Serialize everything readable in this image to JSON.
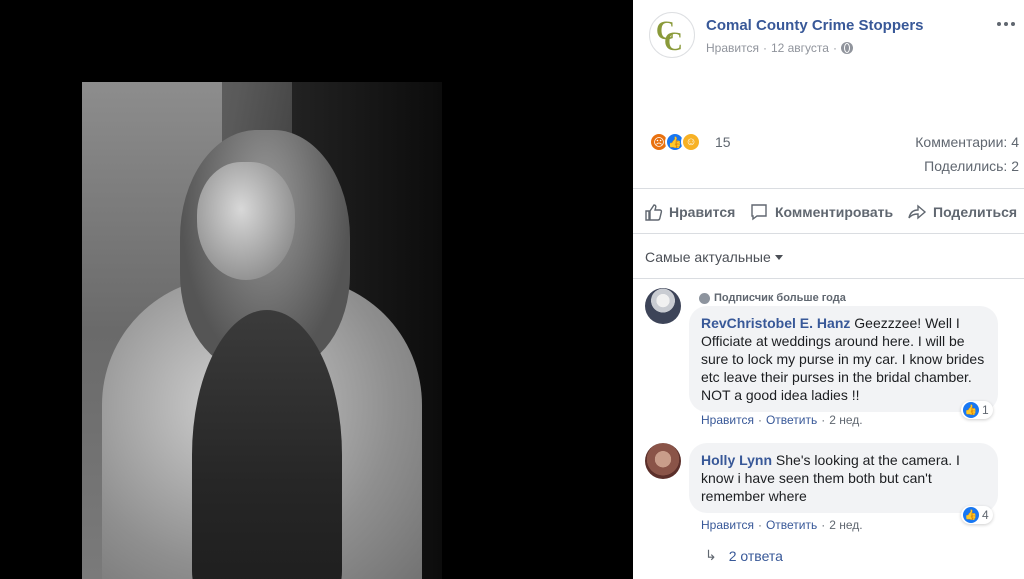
{
  "post": {
    "page_name": "Comal County Crime Stoppers",
    "like_label": "Нравится",
    "separator": "·",
    "date": "12 августа",
    "avatar_text": "CC"
  },
  "stats": {
    "reaction_count": "15",
    "comments": "Комментарии: 4",
    "shares": "Поделились: 2"
  },
  "actions": {
    "like": "Нравится",
    "comment": "Комментировать",
    "share": "Поделиться"
  },
  "sort": {
    "label": "Самые актуальные"
  },
  "comments": [
    {
      "badge": "Подписчик больше года",
      "author": "RevChristobel E. Hanz",
      "text": " Geezzzee! Well I Officiate at weddings around here. I will be sure to lock my purse in my car. I know brides etc leave their purses in the bridal chamber. NOT a good idea ladies !!",
      "like": "Нравится",
      "reply": "Ответить",
      "time": "2 нед.",
      "likes": "1"
    },
    {
      "author": "Holly Lynn",
      "text": " She's looking at the camera. I know i have seen them both but can't remember where",
      "like": "Нравится",
      "reply": "Ответить",
      "time": "2 нед.",
      "likes": "4"
    }
  ],
  "replies": {
    "label": "2 ответа"
  },
  "colors": {
    "link": "#385898",
    "like_blue": "#1877f2",
    "angry": "#e9710f",
    "haha": "#f7b125"
  }
}
